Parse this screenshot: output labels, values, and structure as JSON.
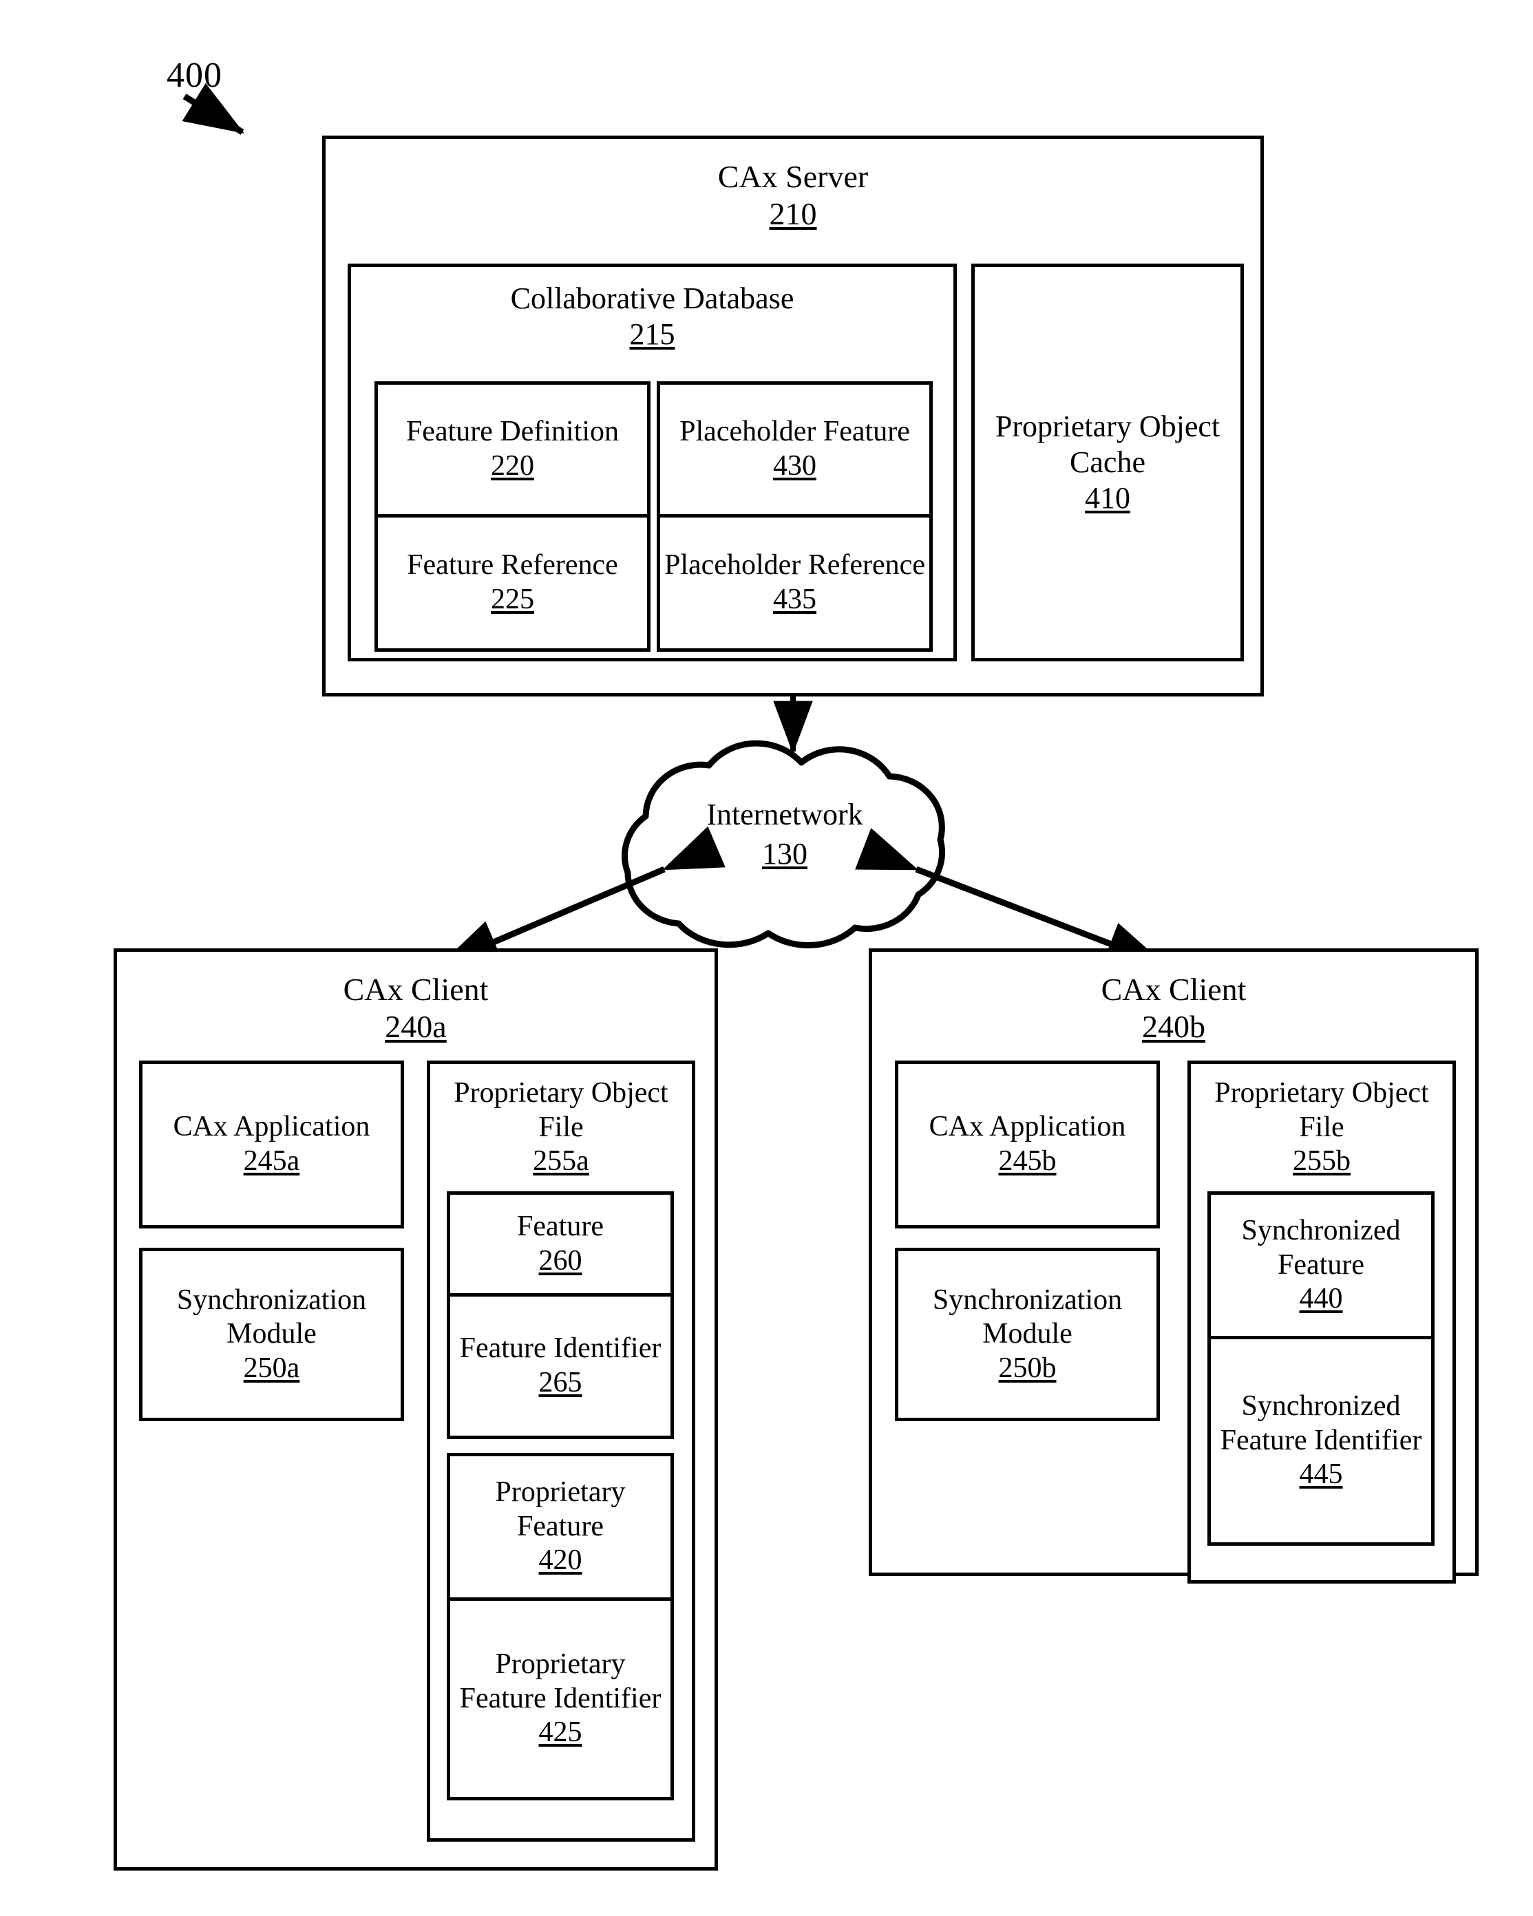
{
  "figure": {
    "number": "400"
  },
  "server": {
    "title": "CAx Server",
    "ref": "210",
    "collaborative_database": {
      "title": "Collaborative Database",
      "ref": "215",
      "cells": [
        {
          "title": "Feature\nDefinition",
          "ref": "220"
        },
        {
          "title": "Placeholder\nFeature",
          "ref": "430"
        },
        {
          "title": "Feature\nReference",
          "ref": "225"
        },
        {
          "title": "Placeholder\nReference",
          "ref": "435"
        }
      ]
    },
    "proprietary_object_cache": {
      "title": "Proprietary\nObject Cache",
      "ref": "410"
    }
  },
  "network": {
    "title": "Internetwork",
    "ref": "130"
  },
  "client_a": {
    "title": "CAx Client",
    "ref": "240a",
    "application": {
      "title": "CAx\nApplication",
      "ref": "245a"
    },
    "sync_module": {
      "title": "Synchronization\nModule",
      "ref": "250a"
    },
    "object_file": {
      "title": "Proprietary\nObject File",
      "ref": "255a",
      "group_one": [
        {
          "title": "Feature",
          "ref": "260"
        },
        {
          "title": "Feature\nIdentifier",
          "ref": "265"
        }
      ],
      "group_two": [
        {
          "title": "Proprietary\nFeature",
          "ref": "420"
        },
        {
          "title": "Proprietary\nFeature\nIdentifier",
          "ref": "425"
        }
      ]
    }
  },
  "client_b": {
    "title": "CAx Client",
    "ref": "240b",
    "application": {
      "title": "CAx\nApplication",
      "ref": "245b"
    },
    "sync_module": {
      "title": "Synchronization\nModule",
      "ref": "250b"
    },
    "object_file": {
      "title": "Proprietary\nObject File",
      "ref": "255b",
      "group_one": [
        {
          "title": "Synchronized\nFeature",
          "ref": "440"
        },
        {
          "title": "Synchronized\nFeature\nIdentifier",
          "ref": "445"
        }
      ]
    }
  },
  "colors": {
    "stroke": "#000000",
    "background": "#ffffff"
  }
}
